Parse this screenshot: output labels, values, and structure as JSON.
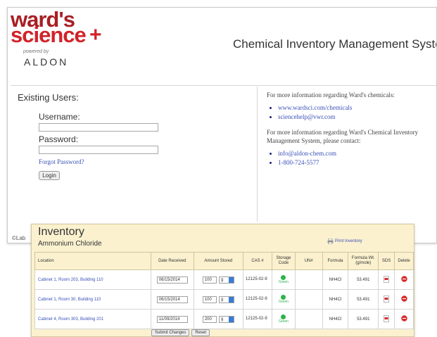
{
  "login_page": {
    "brand": {
      "wards": "ward's",
      "science": "science",
      "plus": "+",
      "powered": "powered by",
      "aldon": "ALDON"
    },
    "app_title": "Chemical Inventory Management System",
    "existing_users": "Existing Users:",
    "username_label": "Username:",
    "username_value": "",
    "password_label": "Password:",
    "password_value": "",
    "forgot_password": "Forgot Password?",
    "login_button": "Login",
    "info": {
      "para1": "For more information regarding Ward's chemicals:",
      "links1": [
        "www.wardsci.com/chemicals",
        "sciencehelp@vwr.com"
      ],
      "para2": "For more information regarding Ward's Chemical Inventory Management System, please contact:",
      "links2": [
        "info@aldon-chem.com",
        "1-800-724-5577"
      ]
    },
    "footer": "©Lab"
  },
  "inventory": {
    "title": "Inventory",
    "subtitle": "Ammonium Chloride",
    "print_link": "Print Inventory",
    "columns": {
      "location": "Location",
      "date": "Date Received",
      "amount": "Amount Stored",
      "cas": "CAS #",
      "storage": "Storage Code",
      "unit": "UN#",
      "formula": "Formula",
      "fw": "Formula Wt. (g/mole)",
      "sds": "SDS",
      "delete": "Delete"
    },
    "rows": [
      {
        "location": "Cabinet 1, Room 203, Building 110",
        "date": "06/15/2014",
        "amount": "100",
        "unit": "g",
        "cas": "12125-02-9",
        "storage": "Green",
        "un": "",
        "formula": "NH4Cl",
        "fw": "53.491"
      },
      {
        "location": "Cabinet 1, Room 30, Building 110",
        "date": "06/15/2014",
        "amount": "100",
        "unit": "g",
        "cas": "12125-02-9",
        "storage": "Green",
        "un": "",
        "formula": "NH4Cl",
        "fw": "53.491"
      },
      {
        "location": "Cabinet 4, Room 303, Building 201",
        "date": "11/09/2014",
        "amount": "200",
        "unit": "g",
        "cas": "12125-02-9",
        "storage": "Green",
        "un": "",
        "formula": "NH4Cl",
        "fw": "53.491"
      }
    ],
    "submit_button": "Submit Changes",
    "reset_button": "Reset"
  },
  "colors": {
    "brand_red": "#d2232a",
    "link_blue": "#3a51b8",
    "inventory_bg": "#fbf1cf",
    "storage_green": "#2db34a",
    "delete_red": "#d62828"
  }
}
